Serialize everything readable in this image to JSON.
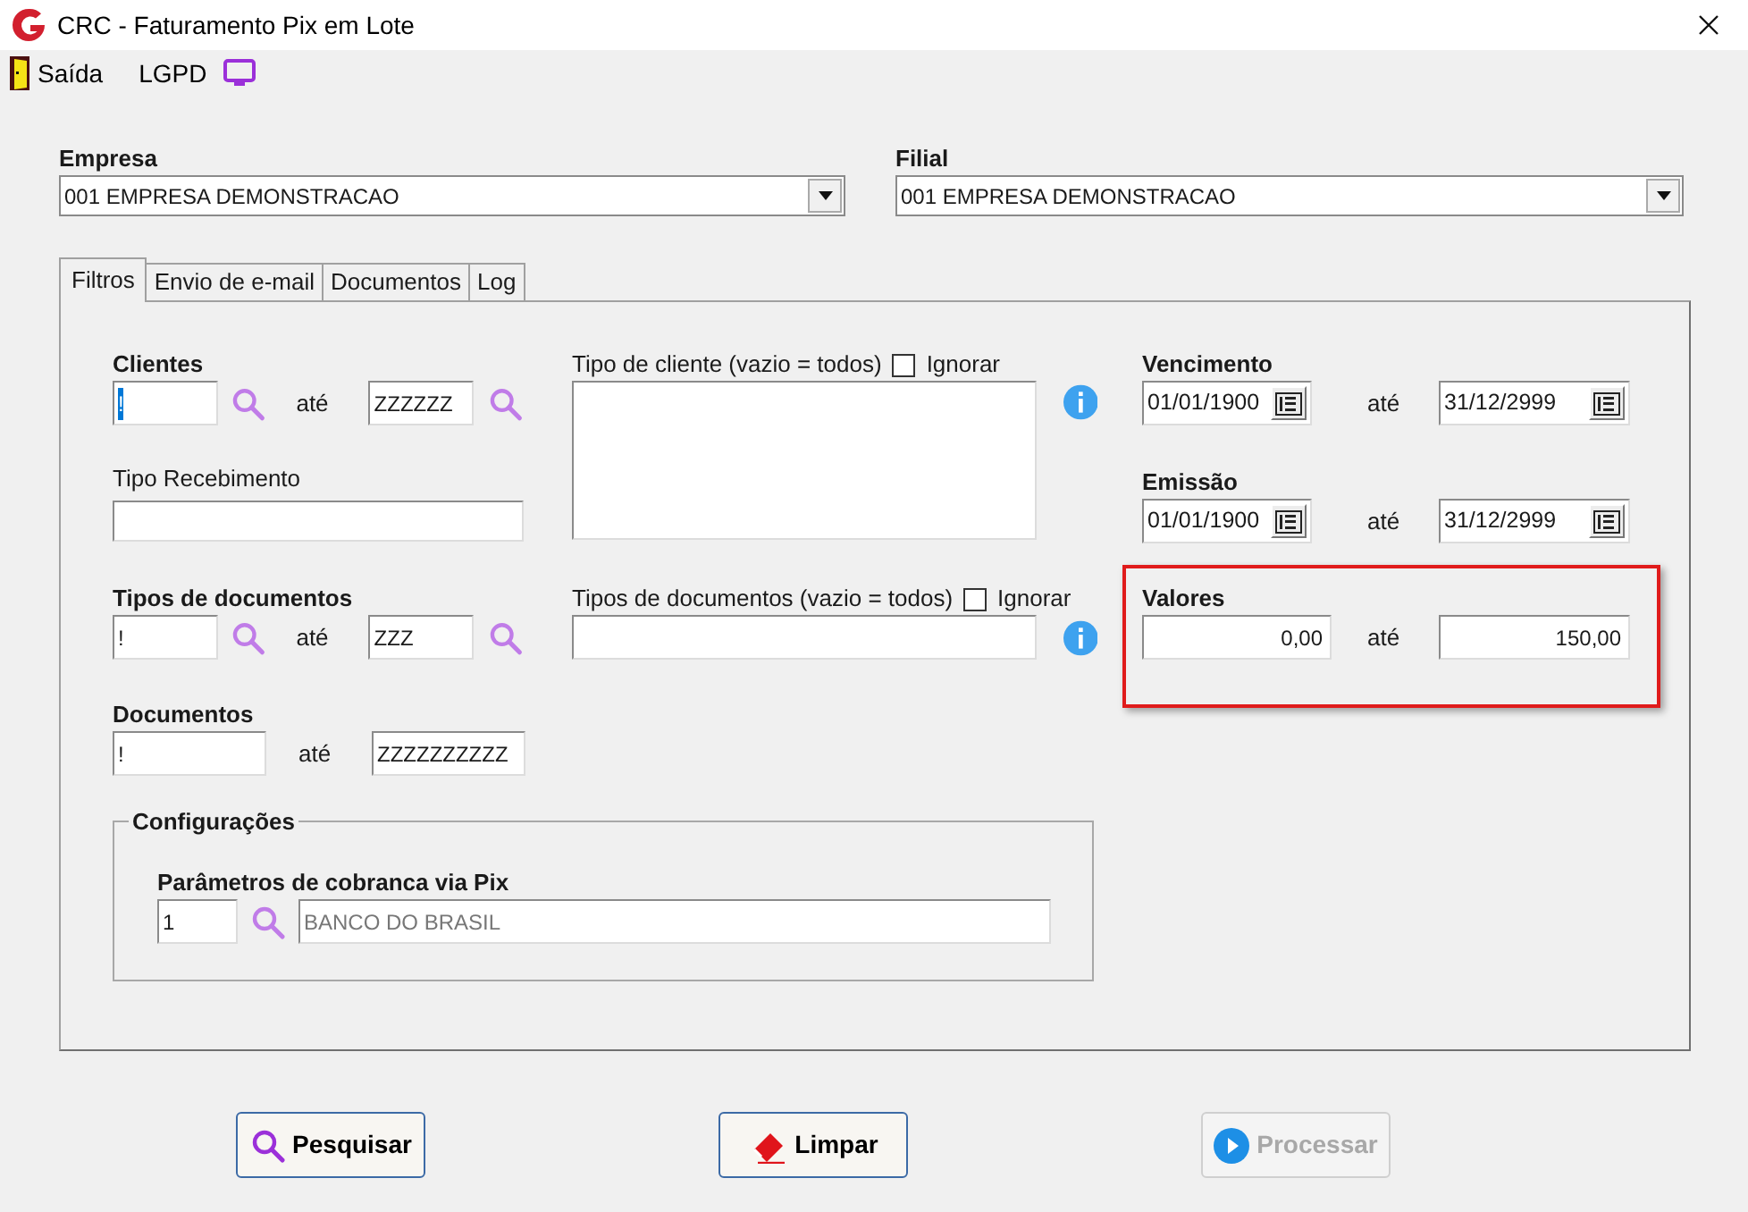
{
  "window": {
    "title": "CRC - Faturamento Pix em Lote"
  },
  "menu": [
    {
      "kind": "door",
      "label": "Saída"
    },
    {
      "kind": "monitor",
      "label": "LGPD"
    }
  ],
  "empresa": {
    "label": "Empresa",
    "value": "001 EMPRESA DEMONSTRACAO"
  },
  "filial": {
    "label": "Filial",
    "value": "001 EMPRESA DEMONSTRACAO"
  },
  "tabs": [
    {
      "label": "Filtros",
      "selected": true
    },
    {
      "label": "Envio de e-mail",
      "selected": false
    },
    {
      "label": "Documentos",
      "selected": false
    },
    {
      "label": "Log",
      "selected": false
    }
  ],
  "clientes": {
    "label": "Clientes",
    "from": "!",
    "from_highlighted": true,
    "separator": "até",
    "to": "ZZZZZZ"
  },
  "tipo_recebimento": {
    "label": "Tipo Recebimento"
  },
  "tipo_cliente": {
    "label": "Tipo de cliente (vazio = todos)",
    "ignore_label": "Ignorar",
    "ignore_checked": false
  },
  "tipos_documentos": {
    "label": "Tipos de documentos",
    "from": "!",
    "from_highlighted": false,
    "separator": "até",
    "to": "ZZZ"
  },
  "tipos_documentos_filtro": {
    "label": "Tipos de documentos (vazio = todos)",
    "ignore_label": "Ignorar",
    "ignore_checked": false
  },
  "documentos": {
    "label": "Documentos",
    "from": "!",
    "separator": "até",
    "to": "ZZZZZZZZZZ"
  },
  "configuracoes": {
    "title": "Configurações",
    "label": "Parâmetros de cobranca via Pix",
    "code": "1",
    "description": "BANCO DO BRASIL"
  },
  "vencimento": {
    "label": "Vencimento",
    "from": "01/01/1900",
    "separator": "até",
    "to": "31/12/2999"
  },
  "emissao": {
    "label": "Emissão",
    "from": "01/01/1900",
    "separator": "até",
    "to": "31/12/2999"
  },
  "valores": {
    "label": "Valores",
    "from": "0,00",
    "separator": "até",
    "to": "150,00",
    "highlighted": true
  },
  "buttons": [
    {
      "kind": "search",
      "label": "Pesquisar",
      "disabled": false
    },
    {
      "kind": "eraser",
      "label": "Limpar",
      "disabled": false
    },
    {
      "kind": "play",
      "label": "Processar",
      "disabled": true
    }
  ]
}
